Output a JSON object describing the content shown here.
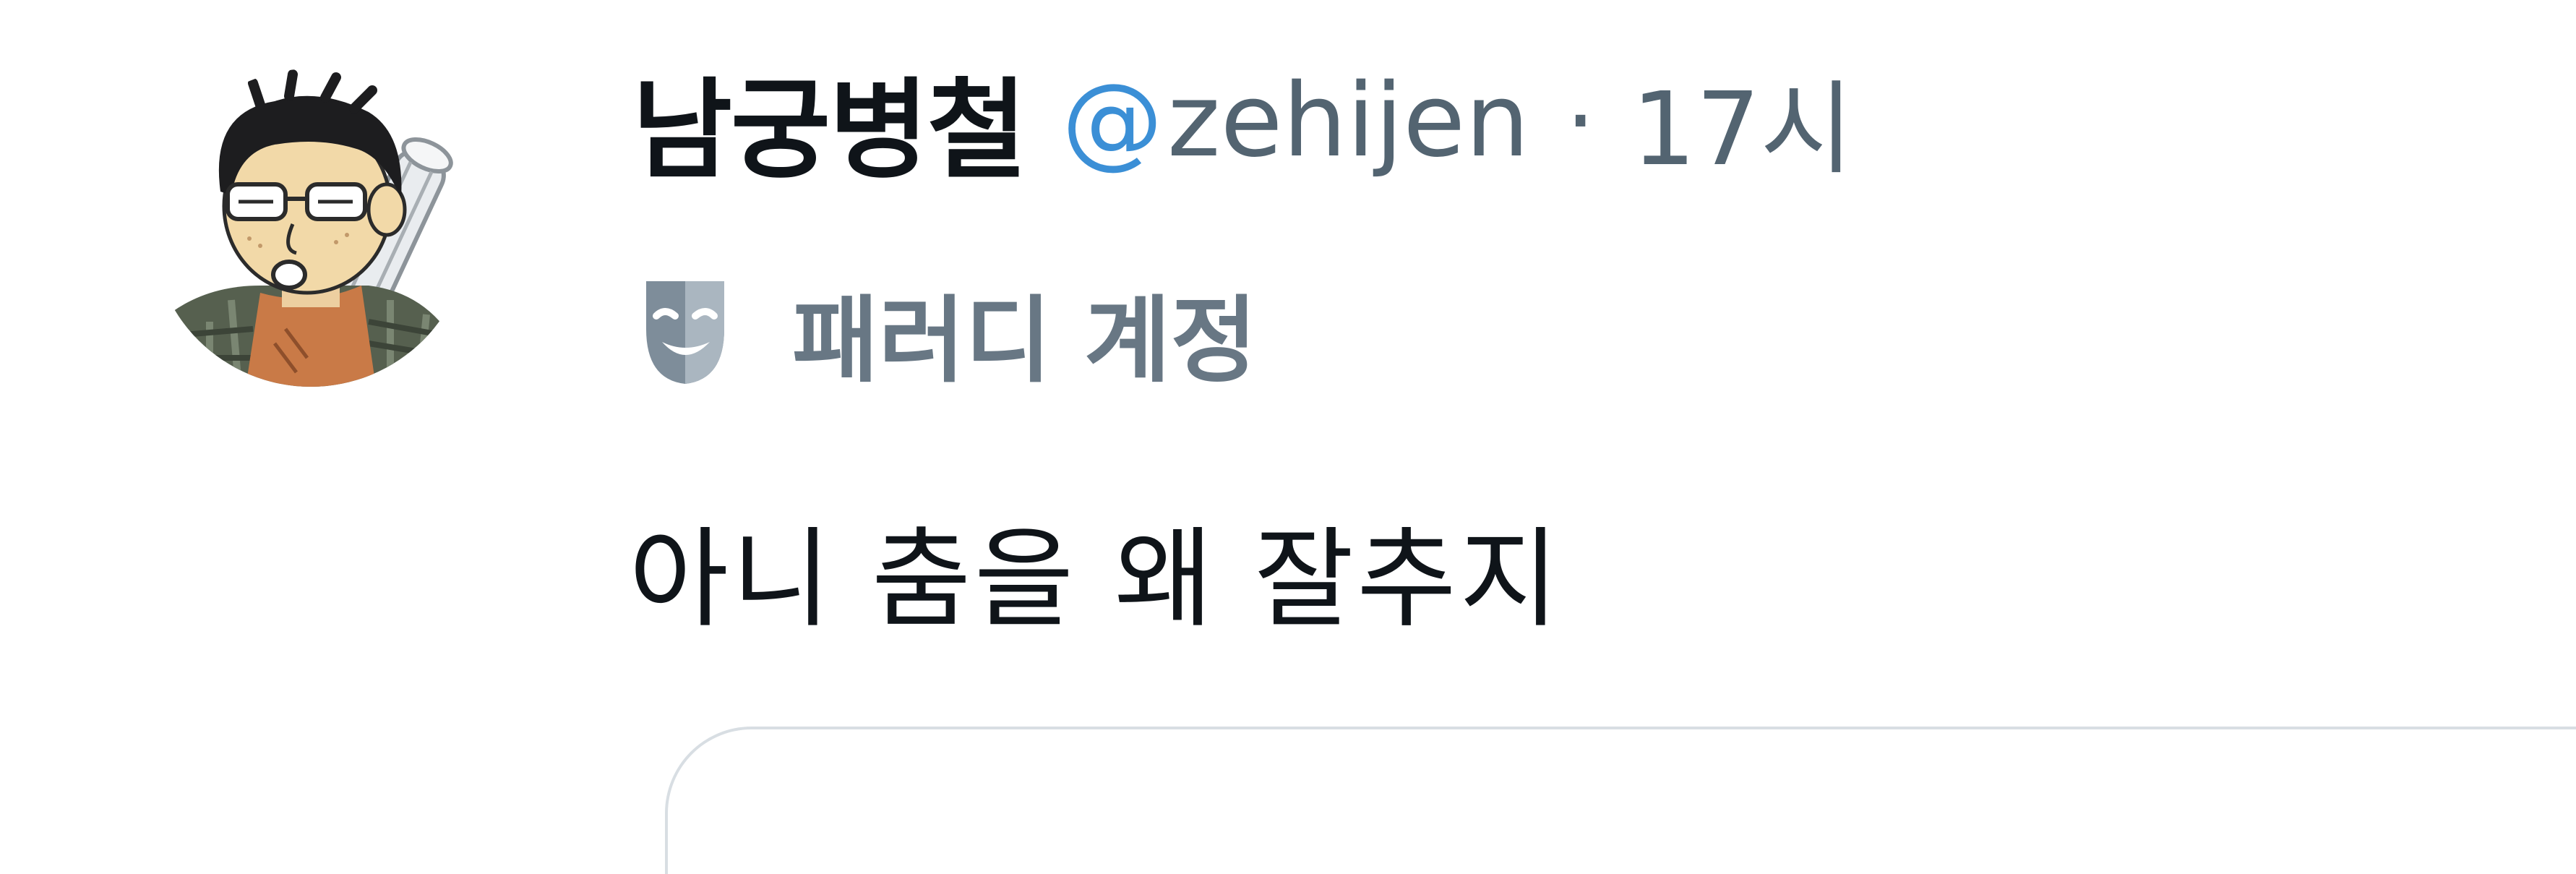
{
  "tweet": {
    "author": {
      "display_name": "남궁병철",
      "handle_at": "@",
      "handle_name": "zehijen",
      "avatar_icon": "cartoon-avatar-icon"
    },
    "separator": "·",
    "timestamp": "17시",
    "parody": {
      "icon": "theater-mask-icon",
      "label": "패러디 계정"
    },
    "text": "아니 춤을 왜 잘추지"
  },
  "colors": {
    "text_primary": "#0f1419",
    "text_secondary": "#536471",
    "at_accent": "#3b8fd6",
    "parody_label": "#687784",
    "card_border": "#d8dee3"
  }
}
